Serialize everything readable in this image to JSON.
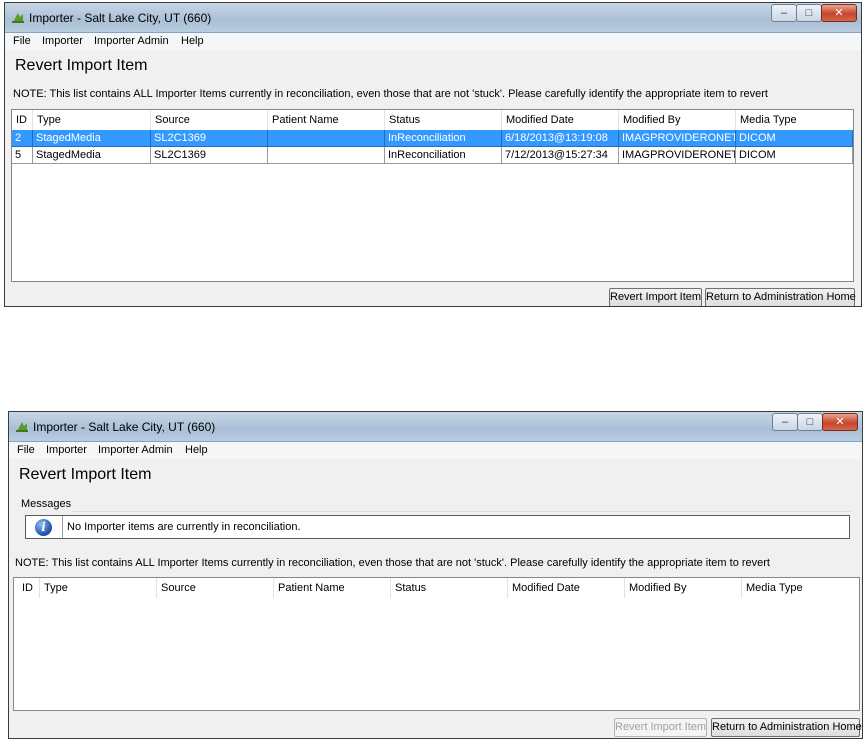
{
  "colors": {
    "selection": "#3399ff",
    "titlebar": "#b9cde0",
    "close_button": "#c7452c",
    "info_icon": "#1b4fa8"
  },
  "screen1": {
    "window_title": "Importer - Salt Lake City, UT (660)",
    "window_controls": {
      "minimize": "–",
      "maximize": "□",
      "close": "✕"
    },
    "menu": [
      "File",
      "Importer",
      "Importer Admin",
      "Help"
    ],
    "heading": "Revert Import Item",
    "note": "NOTE: This list contains ALL Importer Items currently in reconciliation, even those that are not 'stuck'. Please carefully identify the appropriate item to revert",
    "columns": [
      "ID",
      "Type",
      "Source",
      "Patient Name",
      "Status",
      "Modified Date",
      "Modified By",
      "Media Type"
    ],
    "rows": [
      {
        "id": "2",
        "type": "StagedMedia",
        "source": "SL2C1369",
        "patient_name": "",
        "status": "InReconciliation",
        "modified_date": "6/18/2013@13:19:08",
        "modified_by": "IMAGPROVIDERONETW",
        "media_type": "DICOM",
        "selected": true
      },
      {
        "id": "5",
        "type": "StagedMedia",
        "source": "SL2C1369",
        "patient_name": "",
        "status": "InReconciliation",
        "modified_date": "7/12/2013@15:27:34",
        "modified_by": "IMAGPROVIDERONETW",
        "media_type": "DICOM",
        "selected": false
      }
    ],
    "revert_button": "Revert Import Item",
    "return_button": "Return to Administration Home"
  },
  "screen2": {
    "window_title": "Importer - Salt Lake City, UT (660)",
    "window_controls": {
      "minimize": "–",
      "maximize": "□",
      "close": "✕"
    },
    "menu": [
      "File",
      "Importer",
      "Importer Admin",
      "Help"
    ],
    "heading": "Revert Import Item",
    "messages_label": "Messages",
    "info_icon_glyph": "i",
    "message": "No Importer items are currently in reconciliation.",
    "note": "NOTE: This list contains ALL Importer Items currently in reconciliation, even those that are not 'stuck'. Please carefully identify the appropriate item to revert",
    "columns": [
      "ID",
      "Type",
      "Source",
      "Patient Name",
      "Status",
      "Modified Date",
      "Modified By",
      "Media Type"
    ],
    "revert_button": "Revert Import Item",
    "revert_disabled": true,
    "return_button": "Return to Administration Home"
  }
}
